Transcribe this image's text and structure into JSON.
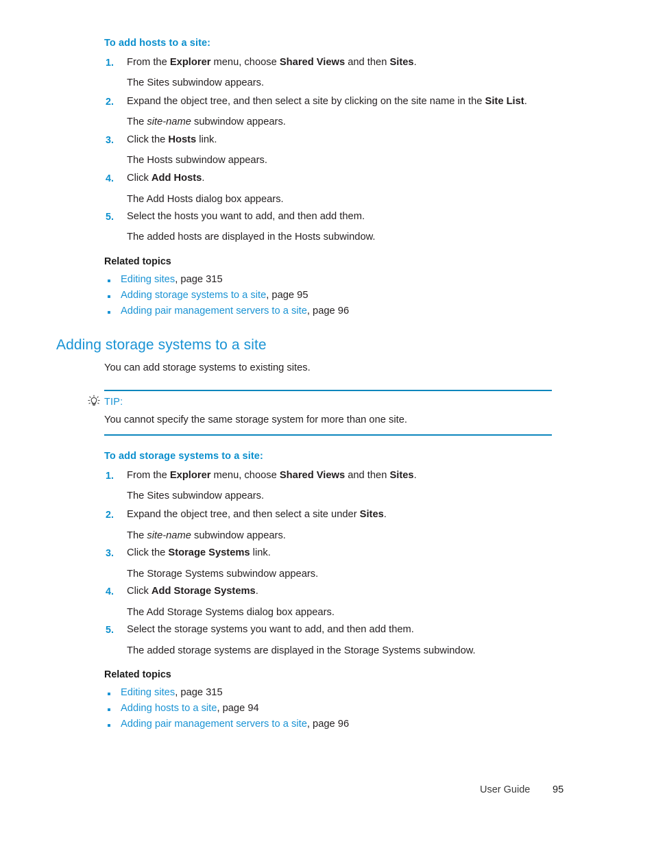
{
  "page": {
    "accent_blue": "#1a93d4",
    "heading_blue": "#0b8fcd",
    "rule_blue": "#0c86bd",
    "body_color": "#231f20"
  },
  "section_one": {
    "procedure_heading": "To add hosts to a site:",
    "steps": [
      {
        "number": "1.",
        "text_html": "From the <b>Explorer</b> menu, choose <b>Shared Views</b> and then <b>Sites</b>.",
        "result": "The Sites subwindow appears."
      },
      {
        "number": "2.",
        "text_html": "Expand the object tree, and then select a site by clicking on the site name in the <b>Site List</b>.",
        "result_html": "The <i>site-name</i> subwindow appears."
      },
      {
        "number": "3.",
        "text_html": "Click the <b>Hosts</b> link.",
        "result": "The Hosts subwindow appears."
      },
      {
        "number": "4.",
        "text_html": "Click <b>Add Hosts</b>.",
        "result": "The Add Hosts dialog box appears."
      },
      {
        "number": "5.",
        "text_html": "Select the hosts you want to add, and then add them.",
        "result": "The added hosts are displayed in the Hosts subwindow."
      }
    ],
    "related_heading": "Related topics",
    "related_links": [
      {
        "link": "Editing sites",
        "suffix": ", page 315"
      },
      {
        "link": "Adding storage systems to a site",
        "suffix": ", page 95"
      },
      {
        "link": "Adding pair management servers to a site",
        "suffix": ", page 96"
      }
    ]
  },
  "section_two": {
    "heading": "Adding storage systems to a site",
    "intro": "You can add storage systems to existing sites.",
    "tip": {
      "icon": "lightbulb-icon",
      "label": "TIP:",
      "body": "You cannot specify the same storage system for more than one site."
    },
    "procedure_heading": "To add storage systems to a site:",
    "steps": [
      {
        "number": "1.",
        "text_html": "From the <b>Explorer</b> menu, choose <b>Shared Views</b> and then <b>Sites</b>.",
        "result": "The Sites subwindow appears."
      },
      {
        "number": "2.",
        "text_html": "Expand the object tree, and then select a site under <b>Sites</b>.",
        "result_html": "The <i>site-name</i> subwindow appears."
      },
      {
        "number": "3.",
        "text_html": "Click the <b>Storage Systems</b> link.",
        "result": "The Storage Systems subwindow appears."
      },
      {
        "number": "4.",
        "text_html": "Click <b>Add Storage Systems</b>.",
        "result": "The Add Storage Systems dialog box appears."
      },
      {
        "number": "5.",
        "text_html": "Select the storage systems you want to add, and then add them.",
        "result": "The added storage systems are displayed in the Storage Systems subwindow."
      }
    ],
    "related_heading": "Related topics",
    "related_links": [
      {
        "link": "Editing sites",
        "suffix": ", page 315"
      },
      {
        "link": "Adding hosts to a site",
        "suffix": ", page 94"
      },
      {
        "link": "Adding pair management servers to a site",
        "suffix": ", page 96"
      }
    ]
  },
  "footer": {
    "label": "User Guide",
    "page_number": "95"
  }
}
